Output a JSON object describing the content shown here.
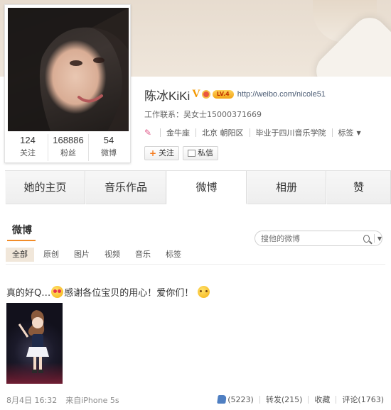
{
  "profile": {
    "name": "陈冰KiKi",
    "verified_mark": "V",
    "level_badge": "LV.4",
    "url": "http://weibo.com/nicole51",
    "contact": "工作联系：吴女士15000371669",
    "tags": [
      "金牛座",
      "北京 朝阳区",
      "毕业于四川音乐学院"
    ],
    "tags_link": "标签",
    "follow_button": "关注",
    "message_button": "私信",
    "stats": [
      {
        "value": "124",
        "label": "关注"
      },
      {
        "value": "168886",
        "label": "粉丝"
      },
      {
        "value": "54",
        "label": "微博"
      }
    ]
  },
  "tabs": [
    "她的主页",
    "音乐作品",
    "微博",
    "相册",
    "赞"
  ],
  "active_tab": "微博",
  "section": {
    "title": "微博",
    "search_placeholder": "搜他的微博",
    "filters": [
      "全部",
      "原创",
      "图片",
      "视频",
      "音乐",
      "标签"
    ]
  },
  "post": {
    "text_a": "真的好Q…",
    "text_b": "感谢各位宝贝的用心！爱你们！",
    "date": "8月4日 16:32",
    "source": "来自iPhone 5s",
    "likes": "(5223)",
    "repost": "转发(215)",
    "favorite": "收藏",
    "comment": "评论(1763)"
  },
  "colors": {
    "accent": "#f28c28",
    "link": "#4a5b73",
    "filter_active_bg": "#f1e7da"
  },
  "icons": [
    "search-icon",
    "pin-icon",
    "plus-icon",
    "message-icon",
    "thumb-icon",
    "emoji-heart-eyes",
    "emoji-kiss"
  ]
}
